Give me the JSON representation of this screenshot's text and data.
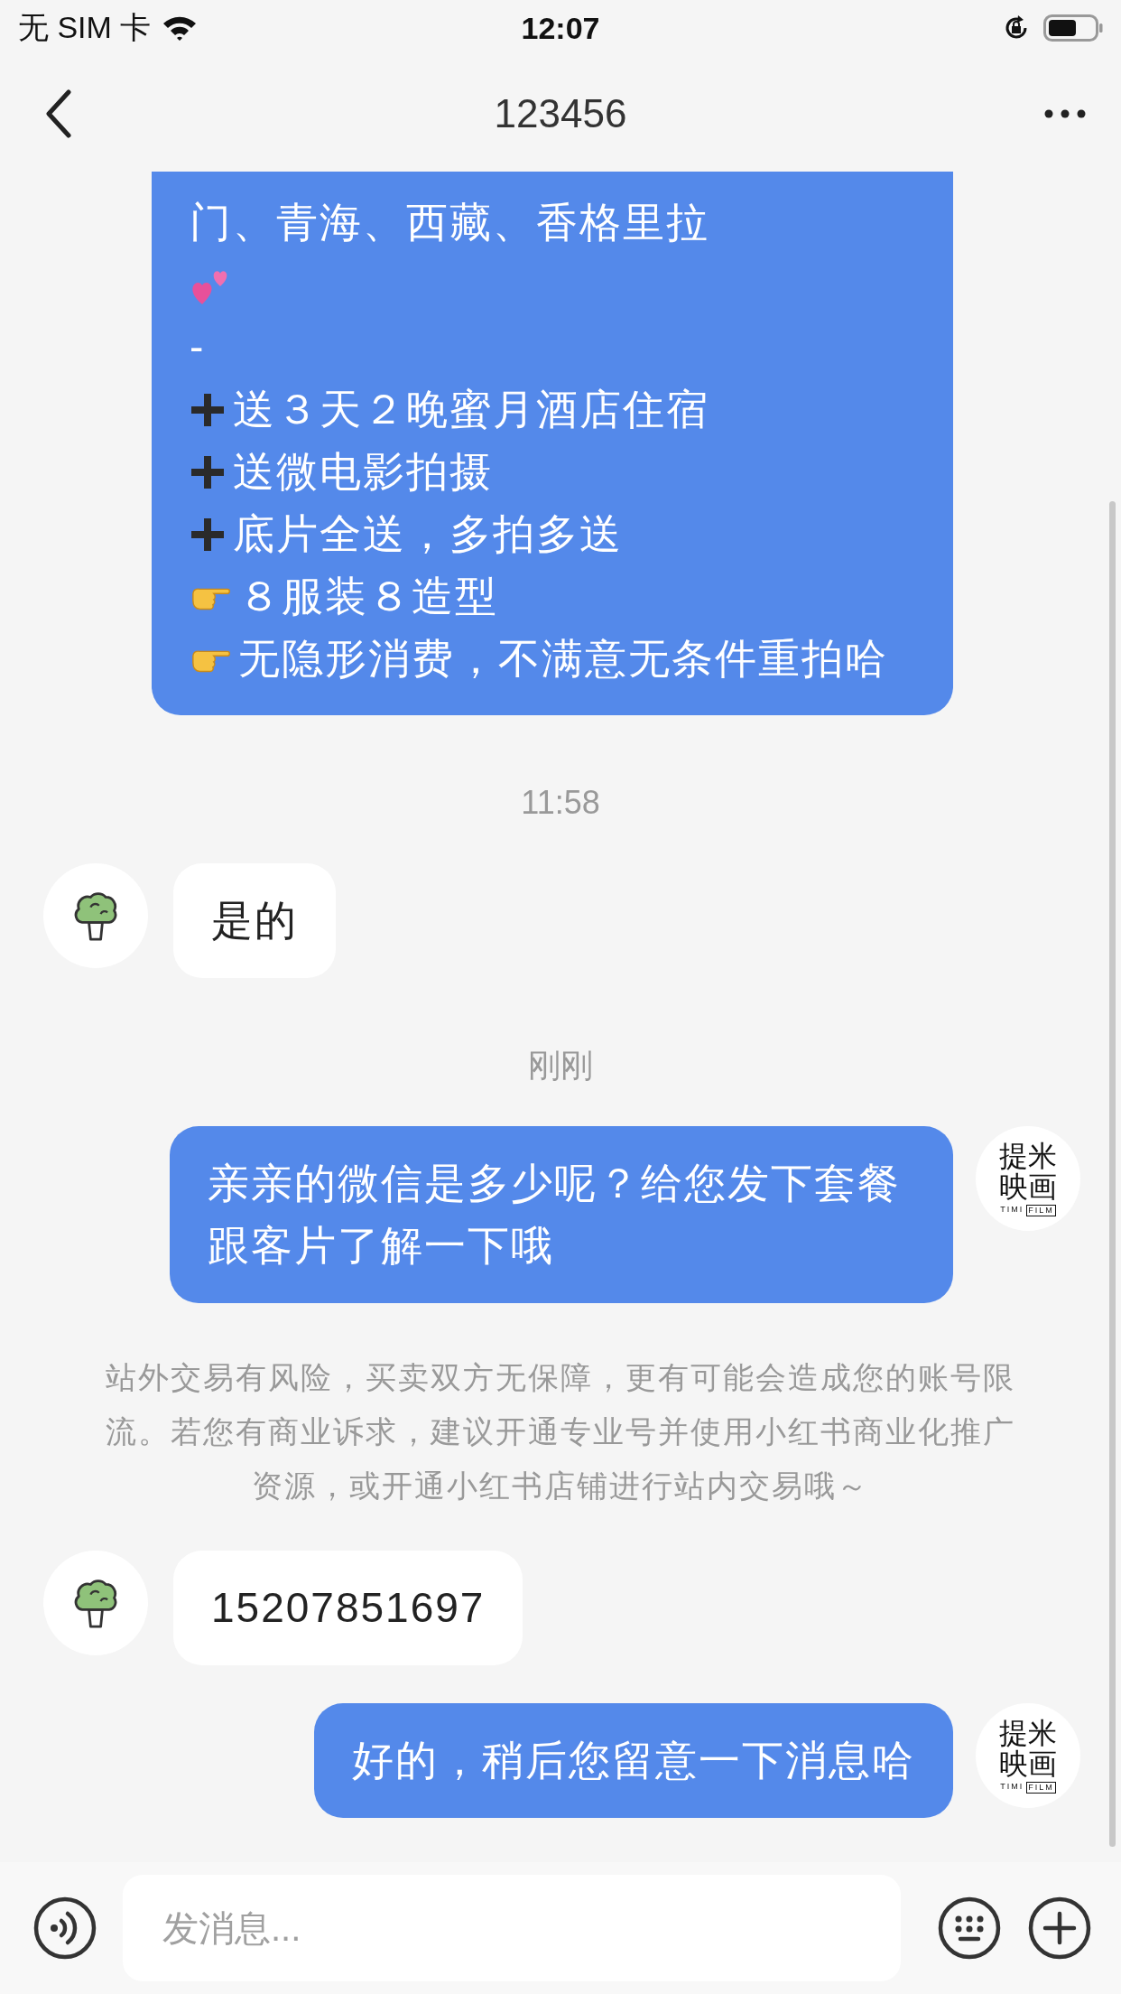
{
  "status_bar": {
    "carrier": "无 SIM 卡",
    "time": "12:07"
  },
  "header": {
    "title": "123456"
  },
  "messages": [
    {
      "kind": "outgoing",
      "lines": [
        {
          "kind": "text",
          "text": "门、青海、西藏、香格里拉"
        },
        {
          "kind": "hearts"
        },
        {
          "kind": "text",
          "text": "-"
        },
        {
          "kind": "plus",
          "text": "送３天２晚蜜月酒店住宿"
        },
        {
          "kind": "plus",
          "text": "送微电影拍摄"
        },
        {
          "kind": "plus",
          "text": "底片全送，多拍多送"
        },
        {
          "kind": "pointer",
          "text": "８服装８造型"
        },
        {
          "kind": "pointer",
          "text": "无隐形消费，不满意无条件重拍哈"
        }
      ]
    },
    {
      "kind": "time",
      "text": "11:58"
    },
    {
      "kind": "incoming",
      "text": "是的"
    },
    {
      "kind": "time",
      "text": "刚刚"
    },
    {
      "kind": "outgoing",
      "text": "亲亲的微信是多少呢？给您发下套餐跟客片了解一下哦",
      "avatar": {
        "line_1": "提米",
        "line_2": "映画",
        "tag_1": "TIMI",
        "tag_2": "FILM"
      }
    },
    {
      "kind": "notice",
      "text": "站外交易有风险，买卖双方无保障，更有可能会造成您的账号限流。若您有商业诉求，建议开通专业号并使用小红书商业化推广资源，或开通小红书店铺进行站内交易哦～"
    },
    {
      "kind": "incoming",
      "text": "15207851697"
    },
    {
      "kind": "outgoing",
      "text": "好的，稍后您留意一下消息哈",
      "avatar": {
        "line_1": "提米",
        "line_2": "映画",
        "tag_1": "TIMI",
        "tag_2": "FILM"
      }
    }
  ],
  "input": {
    "placeholder": "发消息..."
  }
}
